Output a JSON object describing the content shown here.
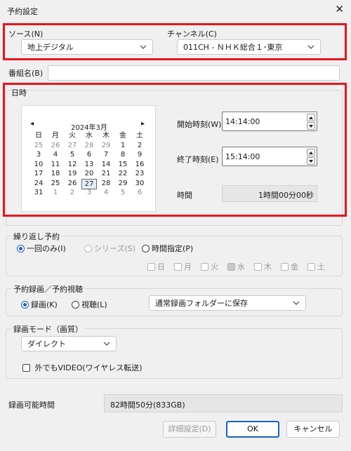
{
  "window": {
    "title": "予約設定",
    "close_glyph": "✕"
  },
  "source": {
    "label": "ソース(N)",
    "value": "地上デジタル"
  },
  "channel": {
    "label": "チャンネル(C)",
    "value": "011CH - ＮＨＫ総合１･東京"
  },
  "program_name": {
    "label": "番組名(B)",
    "value": ""
  },
  "datetime": {
    "group_title": "日時",
    "calendar": {
      "month_title": "2024年3月",
      "prev_glyph": "◂",
      "next_glyph": "▸",
      "weekdays": [
        "日",
        "月",
        "火",
        "水",
        "木",
        "金",
        "土"
      ],
      "rows": [
        [
          "25",
          "26",
          "27",
          "28",
          "29",
          "1",
          "2"
        ],
        [
          "3",
          "4",
          "5",
          "6",
          "7",
          "8",
          "9"
        ],
        [
          "10",
          "11",
          "12",
          "13",
          "14",
          "15",
          "16"
        ],
        [
          "17",
          "18",
          "19",
          "20",
          "21",
          "22",
          "23"
        ],
        [
          "24",
          "25",
          "26",
          "27",
          "28",
          "29",
          "30"
        ],
        [
          "31",
          "1",
          "2",
          "3",
          "4",
          "5",
          "6"
        ]
      ],
      "selected": "27"
    },
    "start_label": "開始時刻(W)",
    "start_value": "14:14:00",
    "end_label": "終了時刻(E)",
    "end_value": "15:14:00",
    "duration_label": "時間",
    "duration_value": "1時間00分00秒"
  },
  "repeat": {
    "group_title": "繰り返し予約",
    "options": [
      "一回のみ(I)",
      "シリーズ(S)",
      "時間指定(P)"
    ],
    "selected": "一回のみ(I)",
    "days": [
      "日",
      "月",
      "火",
      "水",
      "木",
      "金",
      "土"
    ],
    "checked_day": "水"
  },
  "record_view": {
    "group_title": "予約録画／予約視聴",
    "options": [
      "録画(K)",
      "視聴(L)"
    ],
    "selected": "録画(K)",
    "folder_value": "通常録画フォルダーに保存"
  },
  "record_mode": {
    "group_title": "録画モード（画質）",
    "mode_value": "ダイレクト",
    "outside_label": "外でもVIDEO(ワイヤレス転送)"
  },
  "available": {
    "label": "録画可能時間",
    "value": "82時間50分(833GB)"
  },
  "buttons": {
    "details": "詳細設定(D)",
    "ok": "OK",
    "cancel": "キャンセル"
  },
  "colors": {
    "highlight": "#e8141c",
    "accent": "#1a60c5",
    "background": "#f0f0f0"
  }
}
